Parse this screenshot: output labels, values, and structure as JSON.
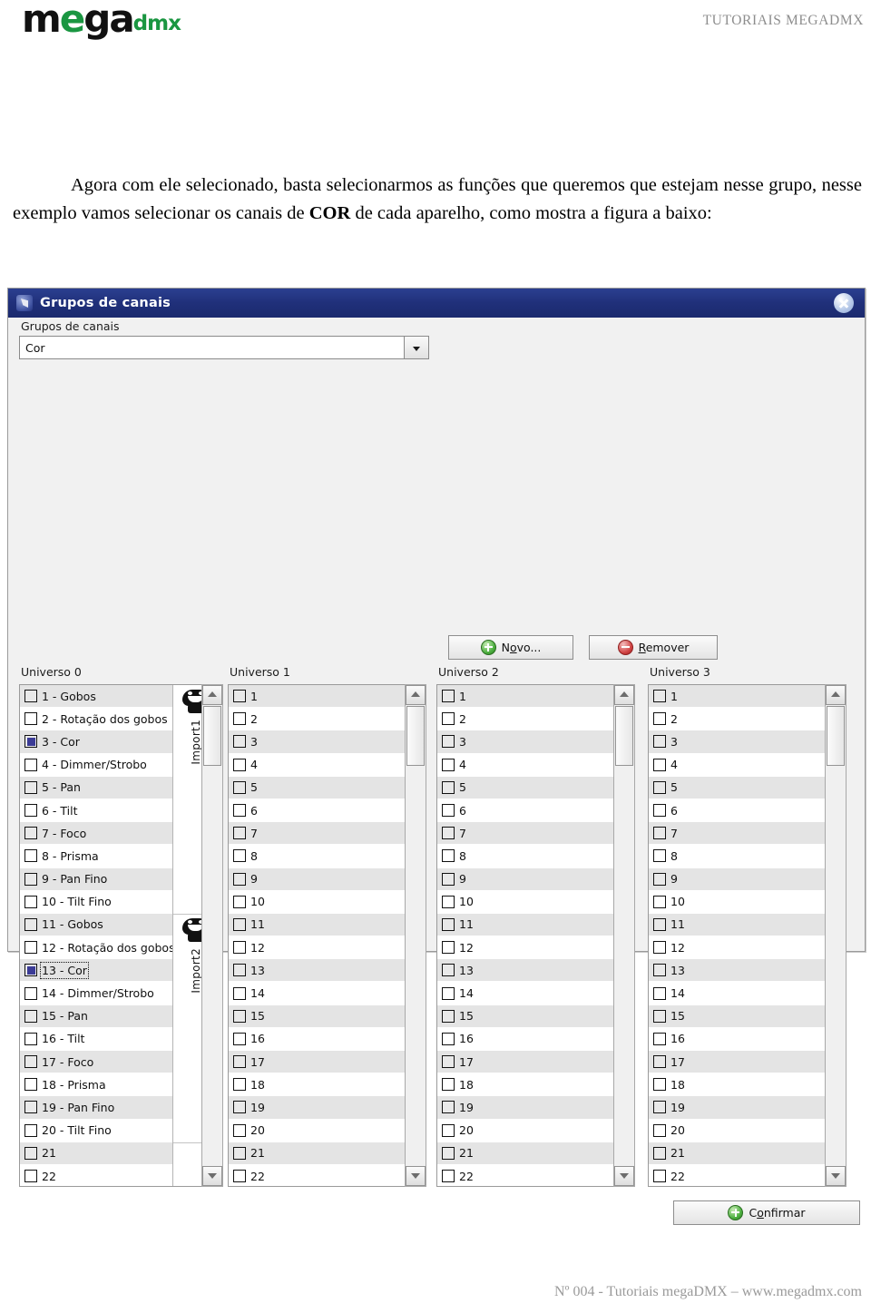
{
  "header": {
    "logo_main": "m",
    "logo_e": "e",
    "logo_ga": "ga",
    "logo_suffix": "dmx",
    "right_title": "TUTORIAIS MEGADMX"
  },
  "intro": {
    "text_before_bold": "Agora com ele selecionado, basta selecionarmos as funções que queremos que estejam nesse grupo, nesse exemplo vamos selecionar os canais de ",
    "bold_word": "COR",
    "text_after_bold": " de cada aparelho, como mostra a figura a baixo:"
  },
  "dialog": {
    "title": "Grupos de canais",
    "close_tooltip": "Fechar",
    "group_field_label": "Grupos de canais",
    "group_combo_value": "Cor",
    "buttons": {
      "novo": {
        "pre": "N",
        "mnemonic": "o",
        "post": "vo..."
      },
      "novo_label": "Novo...",
      "remover": {
        "pre": "",
        "mnemonic": "R",
        "post": "emover"
      },
      "remover_label": "Remover",
      "confirmar": {
        "pre": "C",
        "mnemonic": "o",
        "post": "nfirmar"
      },
      "confirmar_label": "Confirmar"
    },
    "universes": [
      {
        "header": "Universo 0",
        "rows": [
          {
            "num": "1",
            "label": "1 - Gobos",
            "checked": false,
            "focused": false
          },
          {
            "num": "2",
            "label": "2 - Rotação dos gobos",
            "checked": false,
            "focused": false
          },
          {
            "num": "3",
            "label": "3 - Cor",
            "checked": true,
            "focused": false
          },
          {
            "num": "4",
            "label": "4 - Dimmer/Strobo",
            "checked": false,
            "focused": false
          },
          {
            "num": "5",
            "label": "5 - Pan",
            "checked": false,
            "focused": false
          },
          {
            "num": "6",
            "label": "6 - Tilt",
            "checked": false,
            "focused": false
          },
          {
            "num": "7",
            "label": "7 - Foco",
            "checked": false,
            "focused": false
          },
          {
            "num": "8",
            "label": "8 - Prisma",
            "checked": false,
            "focused": false
          },
          {
            "num": "9",
            "label": "9 - Pan Fino",
            "checked": false,
            "focused": false
          },
          {
            "num": "10",
            "label": "10 - Tilt Fino",
            "checked": false,
            "focused": false
          },
          {
            "num": "11",
            "label": "11 - Gobos",
            "checked": false,
            "focused": false
          },
          {
            "num": "12",
            "label": "12 - Rotação dos gobos",
            "checked": false,
            "focused": false
          },
          {
            "num": "13",
            "label": "13 - Cor",
            "checked": true,
            "focused": true
          },
          {
            "num": "14",
            "label": "14 - Dimmer/Strobo",
            "checked": false,
            "focused": false
          },
          {
            "num": "15",
            "label": "15 - Pan",
            "checked": false,
            "focused": false
          },
          {
            "num": "16",
            "label": "16 - Tilt",
            "checked": false,
            "focused": false
          },
          {
            "num": "17",
            "label": "17 - Foco",
            "checked": false,
            "focused": false
          },
          {
            "num": "18",
            "label": "18 - Prisma",
            "checked": false,
            "focused": false
          },
          {
            "num": "19",
            "label": "19 - Pan Fino",
            "checked": false,
            "focused": false
          },
          {
            "num": "20",
            "label": "20 - Tilt Fino",
            "checked": false,
            "focused": false
          },
          {
            "num": "21",
            "label": "21",
            "checked": false,
            "focused": false
          },
          {
            "num": "22",
            "label": "22",
            "checked": false,
            "focused": false
          }
        ],
        "fixtures": [
          {
            "name": "Import1",
            "icon": "moving-head-fixture-icon"
          },
          {
            "name": "Import2",
            "icon": "moving-head-fixture-icon"
          }
        ]
      },
      {
        "header": "Universo 1",
        "rows": [
          {
            "num": "1",
            "label": "1",
            "checked": false,
            "focused": false
          },
          {
            "num": "2",
            "label": "2",
            "checked": false,
            "focused": false
          },
          {
            "num": "3",
            "label": "3",
            "checked": false,
            "focused": false
          },
          {
            "num": "4",
            "label": "4",
            "checked": false,
            "focused": false
          },
          {
            "num": "5",
            "label": "5",
            "checked": false,
            "focused": false
          },
          {
            "num": "6",
            "label": "6",
            "checked": false,
            "focused": false
          },
          {
            "num": "7",
            "label": "7",
            "checked": false,
            "focused": false
          },
          {
            "num": "8",
            "label": "8",
            "checked": false,
            "focused": false
          },
          {
            "num": "9",
            "label": "9",
            "checked": false,
            "focused": false
          },
          {
            "num": "10",
            "label": "10",
            "checked": false,
            "focused": false
          },
          {
            "num": "11",
            "label": "11",
            "checked": false,
            "focused": false
          },
          {
            "num": "12",
            "label": "12",
            "checked": false,
            "focused": false
          },
          {
            "num": "13",
            "label": "13",
            "checked": false,
            "focused": false
          },
          {
            "num": "14",
            "label": "14",
            "checked": false,
            "focused": false
          },
          {
            "num": "15",
            "label": "15",
            "checked": false,
            "focused": false
          },
          {
            "num": "16",
            "label": "16",
            "checked": false,
            "focused": false
          },
          {
            "num": "17",
            "label": "17",
            "checked": false,
            "focused": false
          },
          {
            "num": "18",
            "label": "18",
            "checked": false,
            "focused": false
          },
          {
            "num": "19",
            "label": "19",
            "checked": false,
            "focused": false
          },
          {
            "num": "20",
            "label": "20",
            "checked": false,
            "focused": false
          },
          {
            "num": "21",
            "label": "21",
            "checked": false,
            "focused": false
          },
          {
            "num": "22",
            "label": "22",
            "checked": false,
            "focused": false
          }
        ],
        "fixtures": []
      },
      {
        "header": "Universo 2",
        "rows": [
          {
            "num": "1",
            "label": "1",
            "checked": false,
            "focused": false
          },
          {
            "num": "2",
            "label": "2",
            "checked": false,
            "focused": false
          },
          {
            "num": "3",
            "label": "3",
            "checked": false,
            "focused": false
          },
          {
            "num": "4",
            "label": "4",
            "checked": false,
            "focused": false
          },
          {
            "num": "5",
            "label": "5",
            "checked": false,
            "focused": false
          },
          {
            "num": "6",
            "label": "6",
            "checked": false,
            "focused": false
          },
          {
            "num": "7",
            "label": "7",
            "checked": false,
            "focused": false
          },
          {
            "num": "8",
            "label": "8",
            "checked": false,
            "focused": false
          },
          {
            "num": "9",
            "label": "9",
            "checked": false,
            "focused": false
          },
          {
            "num": "10",
            "label": "10",
            "checked": false,
            "focused": false
          },
          {
            "num": "11",
            "label": "11",
            "checked": false,
            "focused": false
          },
          {
            "num": "12",
            "label": "12",
            "checked": false,
            "focused": false
          },
          {
            "num": "13",
            "label": "13",
            "checked": false,
            "focused": false
          },
          {
            "num": "14",
            "label": "14",
            "checked": false,
            "focused": false
          },
          {
            "num": "15",
            "label": "15",
            "checked": false,
            "focused": false
          },
          {
            "num": "16",
            "label": "16",
            "checked": false,
            "focused": false
          },
          {
            "num": "17",
            "label": "17",
            "checked": false,
            "focused": false
          },
          {
            "num": "18",
            "label": "18",
            "checked": false,
            "focused": false
          },
          {
            "num": "19",
            "label": "19",
            "checked": false,
            "focused": false
          },
          {
            "num": "20",
            "label": "20",
            "checked": false,
            "focused": false
          },
          {
            "num": "21",
            "label": "21",
            "checked": false,
            "focused": false
          },
          {
            "num": "22",
            "label": "22",
            "checked": false,
            "focused": false
          }
        ],
        "fixtures": []
      },
      {
        "header": "Universo 3",
        "rows": [
          {
            "num": "1",
            "label": "1",
            "checked": false,
            "focused": false
          },
          {
            "num": "2",
            "label": "2",
            "checked": false,
            "focused": false
          },
          {
            "num": "3",
            "label": "3",
            "checked": false,
            "focused": false
          },
          {
            "num": "4",
            "label": "4",
            "checked": false,
            "focused": false
          },
          {
            "num": "5",
            "label": "5",
            "checked": false,
            "focused": false
          },
          {
            "num": "6",
            "label": "6",
            "checked": false,
            "focused": false
          },
          {
            "num": "7",
            "label": "7",
            "checked": false,
            "focused": false
          },
          {
            "num": "8",
            "label": "8",
            "checked": false,
            "focused": false
          },
          {
            "num": "9",
            "label": "9",
            "checked": false,
            "focused": false
          },
          {
            "num": "10",
            "label": "10",
            "checked": false,
            "focused": false
          },
          {
            "num": "11",
            "label": "11",
            "checked": false,
            "focused": false
          },
          {
            "num": "12",
            "label": "12",
            "checked": false,
            "focused": false
          },
          {
            "num": "13",
            "label": "13",
            "checked": false,
            "focused": false
          },
          {
            "num": "14",
            "label": "14",
            "checked": false,
            "focused": false
          },
          {
            "num": "15",
            "label": "15",
            "checked": false,
            "focused": false
          },
          {
            "num": "16",
            "label": "16",
            "checked": false,
            "focused": false
          },
          {
            "num": "17",
            "label": "17",
            "checked": false,
            "focused": false
          },
          {
            "num": "18",
            "label": "18",
            "checked": false,
            "focused": false
          },
          {
            "num": "19",
            "label": "19",
            "checked": false,
            "focused": false
          },
          {
            "num": "20",
            "label": "20",
            "checked": false,
            "focused": false
          },
          {
            "num": "21",
            "label": "21",
            "checked": false,
            "focused": false
          },
          {
            "num": "22",
            "label": "22",
            "checked": false,
            "focused": false
          }
        ],
        "fixtures": []
      }
    ]
  },
  "footer": {
    "text": "Nº 004 - Tutoriais megaDMX – www.megadmx.com"
  },
  "colors": {
    "titlebar": "#20307a",
    "accent_green": "#1a9641",
    "checkbox_checked": "#3b3b96",
    "dialog_bg": "#f1f1f1",
    "row_alt": "#e4e4e4"
  }
}
